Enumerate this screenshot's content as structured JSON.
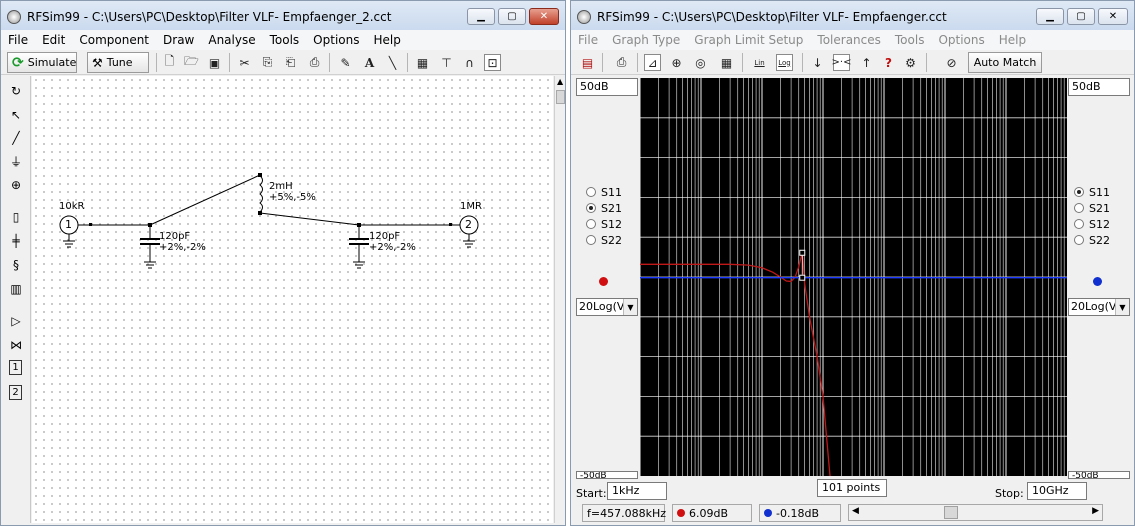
{
  "left_window": {
    "title": "RFSim99 - C:\\Users\\PC\\Desktop\\Filter VLF- Empfaenger_2.cct",
    "menu": [
      "File",
      "Edit",
      "Component",
      "Draw",
      "Analyse",
      "Tools",
      "Options",
      "Help"
    ],
    "toolbar": {
      "simulate_label": "Simulate",
      "tune_label": "Tune"
    },
    "schematic": {
      "port1": {
        "number": "1",
        "label": "10kR"
      },
      "port2": {
        "number": "2",
        "label": "1MR"
      },
      "inductor": {
        "value": "2mH",
        "tolerance": "+5%,-5%"
      },
      "cap1": {
        "value": "120pF",
        "tolerance": "+2%,-2%"
      },
      "cap2": {
        "value": "120pF",
        "tolerance": "+2%,-2%"
      }
    },
    "side_tools": {
      "port1_label": "1",
      "port2_label": "2"
    }
  },
  "right_window": {
    "title": "RFSim99 - C:\\Users\\PC\\Desktop\\Filter VLF- Empfaenger.cct",
    "menu": [
      "File",
      "Graph Type",
      "Graph Limit Setup",
      "Tolerances",
      "Tools",
      "Options",
      "Help"
    ],
    "toolbar": {
      "lin_label": "Lin",
      "log_label": "Log",
      "auto_match_label": "Auto Match",
      "question_label": "?"
    },
    "left_axis": {
      "top": "50dB",
      "bottom": "-50dB",
      "format": "20Log(V)"
    },
    "right_axis": {
      "top": "50dB",
      "bottom": "-50dB",
      "format": "20Log(V)"
    },
    "left_params": [
      {
        "label": "S11",
        "checked": false
      },
      {
        "label": "S21",
        "checked": true
      },
      {
        "label": "S12",
        "checked": false
      },
      {
        "label": "S22",
        "checked": false
      }
    ],
    "right_params": [
      {
        "label": "S11",
        "checked": true
      },
      {
        "label": "S21",
        "checked": false
      },
      {
        "label": "S12",
        "checked": false
      },
      {
        "label": "S22",
        "checked": false
      }
    ],
    "start_label": "Start:",
    "start_value": "1kHz",
    "points_value": "101 points",
    "stop_label": "Stop:",
    "stop_value": "10GHz",
    "status": {
      "freq": "f=457.088kHz",
      "red_value": "6.09dB",
      "blue_value": "-0.18dB"
    },
    "colors": {
      "s21_trace": "#c01818",
      "s11_trace": "#1e3cff",
      "grid": "#ffffff",
      "background": "#000000"
    }
  },
  "chart_data": {
    "type": "line",
    "x_scale": "log",
    "x_range": [
      "1kHz",
      "10GHz"
    ],
    "ylim": [
      -50,
      50
    ],
    "y_unit": "dB",
    "grid": true,
    "series": [
      {
        "name": "S21",
        "color": "#c01818",
        "x_hz": [
          1000,
          10000,
          30000,
          60000,
          100000,
          150000,
          200000,
          250000,
          300000,
          350000,
          400000,
          430000,
          457088,
          500000,
          600000,
          800000,
          1000000,
          1300000
        ],
        "y_db": [
          3.2,
          3.2,
          3.2,
          3.0,
          2.3,
          1.2,
          0.0,
          -1.0,
          -1.1,
          0.0,
          2.5,
          4.5,
          6.09,
          -1.5,
          -10.0,
          -20.0,
          -30.0,
          -50.0
        ]
      },
      {
        "name": "S11",
        "color": "#1e3cff",
        "x_hz": [
          1000,
          10000000000
        ],
        "y_db": [
          -0.18,
          -0.18
        ]
      }
    ]
  }
}
